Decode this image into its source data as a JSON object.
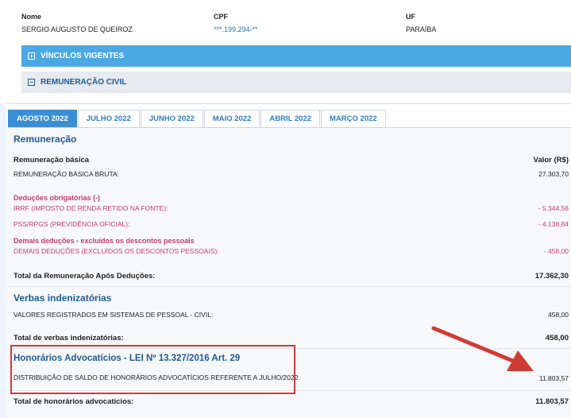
{
  "person": {
    "nome_label": "Nome",
    "nome": "SERGIO AUGUSTO DE QUEIROZ",
    "cpf_label": "CPF",
    "cpf": "***.199.294-**",
    "uf_label": "UF",
    "uf": "PARAÍBA"
  },
  "accordions": {
    "vinculos": "VÍNCULOS VIGENTES",
    "remuneracao": "REMUNERAÇÃO CIVIL"
  },
  "tabs": [
    "AGOSTO 2022",
    "JULHO 2022",
    "JUNHO 2022",
    "MAIO 2022",
    "ABRIL 2022",
    "MARÇO 2022"
  ],
  "active_tab": "AGOSTO 2022",
  "remuneracao": {
    "title": "Remuneração",
    "basica_header": "Remuneração básica",
    "valor_header": "Valor (R$)",
    "bruta_label": "REMUNERAÇÃO BÁSICA BRUTA:",
    "bruta_value": "27.303,70",
    "deducoes_title": "Deduções obrigatórias (-)",
    "irrf_label": "IRRF (IMPOSTO DE RENDA RETIDO NA FONTE):",
    "irrf_value": "- 5.344,56",
    "pss_label": "PSS/RPGS (PREVIDÊNCIA OFICIAL):",
    "pss_value": "- 4.138,84",
    "demais_title": "Demais deduções - excluídos os descontos pessoais",
    "demais_label": "DEMAIS DEDUÇÕES (EXCLUÍDOS OS DESCONTOS PESSOAIS):",
    "demais_value": "- 458,00",
    "total_label": "Total da Remuneração Após Deduções:",
    "total_value": "17.362,30"
  },
  "verbas": {
    "title": "Verbas indenizatórias",
    "item_label": "VALORES REGISTRADOS EM SISTEMAS DE PESSOAL - CIVIL:",
    "item_value": "458,00",
    "total_label": "Total de verbas indenizatórias:",
    "total_value": "458,00"
  },
  "honorarios": {
    "title": "Honorários Advocatícios - LEI Nº 13.327/2016 Art. 29",
    "item_label": "DISTRIBUIÇÃO DE SALDO DE HONORÁRIOS ADVOCATÍCIOS REFERENTE A JULHO/2022",
    "item_value": "11.803,57",
    "total_label": "Total de honorários advocatícios:",
    "total_value": "11.803,57"
  },
  "colors": {
    "active_tab": "#3a8fd4",
    "accordion_blue": "#4aa8e3",
    "deduction_pink": "#c73c6b",
    "annotation_red": "#d23a34"
  }
}
